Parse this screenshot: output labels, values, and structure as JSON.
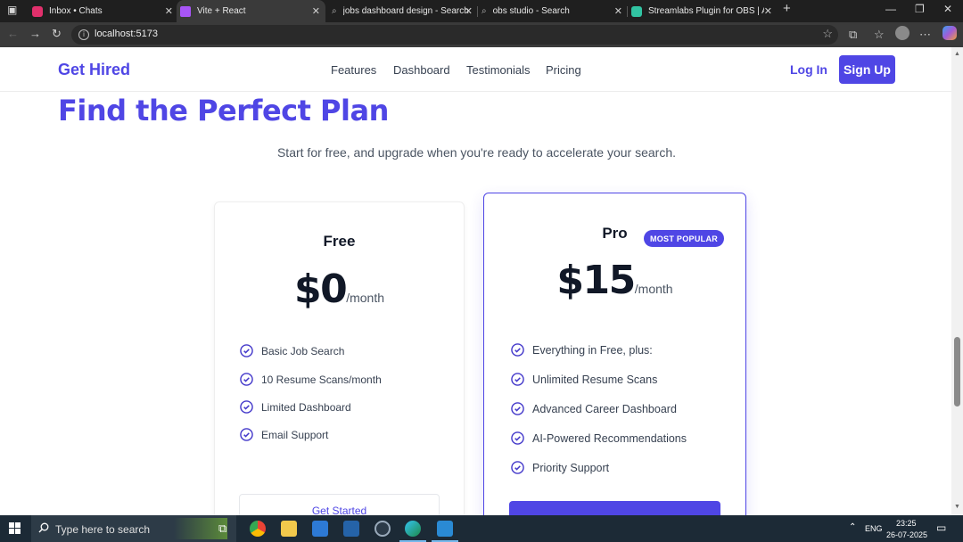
{
  "browser": {
    "tabs": [
      {
        "title": "Inbox • Chats",
        "fav_color": "#e1306c"
      },
      {
        "title": "Vite + React",
        "fav_color": "#a855f7"
      },
      {
        "title": "jobs dashboard design - Search",
        "fav_color": "#2b7de9"
      },
      {
        "title": "obs studio - Search",
        "fav_color": "#2b7de9"
      },
      {
        "title": "Streamlabs Plugin for OBS | Add Li",
        "fav_color": "#31c3a2"
      }
    ],
    "url": "localhost:5173"
  },
  "site": {
    "logo": "Get Hired",
    "nav": [
      "Features",
      "Dashboard",
      "Testimonials",
      "Pricing"
    ],
    "login": "Log In",
    "signup": "Sign Up"
  },
  "pricing": {
    "heading": "Find the Perfect Plan",
    "subheading": "Start for free, and upgrade when you're ready to accelerate your search.",
    "badge": "MOST POPULAR",
    "plans": [
      {
        "name": "Free",
        "price": "$0",
        "period": "/month",
        "features": [
          "Basic Job Search",
          "10 Resume Scans/month",
          "Limited Dashboard",
          "Email Support"
        ],
        "cta": "Get Started"
      },
      {
        "name": "Pro",
        "price": "$15",
        "period": "/month",
        "features": [
          "Everything in Free, plus:",
          "Unlimited Resume Scans",
          "Advanced Career Dashboard",
          "AI-Powered Recommendations",
          "Priority Support"
        ]
      }
    ]
  },
  "taskbar": {
    "search_placeholder": "Type here to search",
    "language": "ENG",
    "time": "23:25",
    "date": "26-07-2025"
  },
  "colors": {
    "accent": "#4f46e5",
    "check": "#4338ca"
  }
}
